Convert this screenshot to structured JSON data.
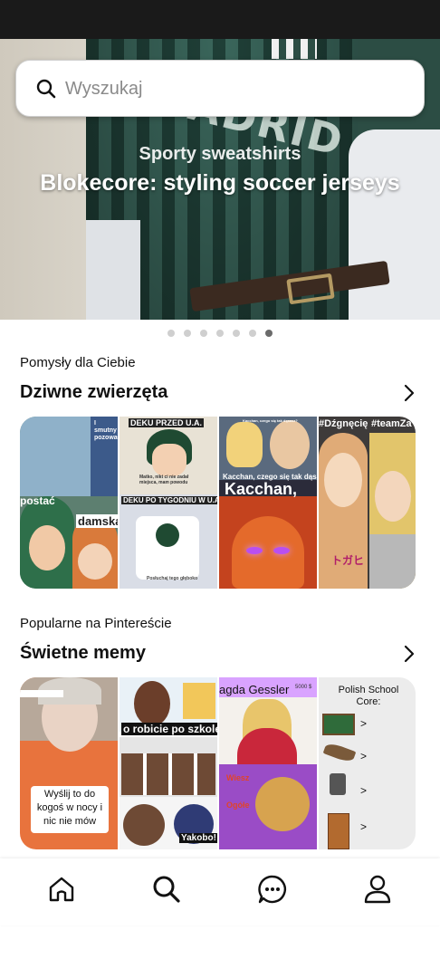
{
  "hero": {
    "subtitle": "Sporty sweatshirts",
    "title": "Blokecore: styling soccer jerseys",
    "jersey_text": "MADRID"
  },
  "search": {
    "placeholder": "Wyszukaj",
    "icon": "search-icon"
  },
  "carousel": {
    "count": 7,
    "active_index": 6
  },
  "section1": {
    "caption": "Pomysły dla Ciebie",
    "title": "Dziwne zwierzęta",
    "tiles": {
      "t1_top": "I smutny pozowała",
      "t1_bottom_left": "postać",
      "t1_bottom_right": "damska",
      "t2_top": "DEKU PRZED U.A.",
      "t2_caption": "Matko, nikt ci nie zadał miejsca, mam powodu",
      "t2_bottom": "DEKU PO TYGODNIU W U.A.",
      "t2_bed": "Posłuchaj tego głęboko",
      "t3_top": "Kacchan, czego się tak dąsasz?",
      "t3_big": "Kacchan,",
      "t3_small": "Kacchan, czego się tak dąsasz?",
      "t4_left": "#Dźgnęcię",
      "t4_right": "#teamZa",
      "t4_sign": "トガヒ"
    }
  },
  "section2": {
    "caption": "Popularne na Pintereście",
    "title": "Świetne memy",
    "tiles": {
      "m1_caption": "Wyślij to do kogoś w nocy i nic nie mów",
      "m2_top": "o robicie po szkole",
      "m2_yakobo": "Yakobo!",
      "m3_name": "agda Gessler",
      "m3_price": "5000 $",
      "m3_red1": "Wiesz",
      "m3_red2": "Ogółe",
      "m4_title": "Polish School Core:",
      "m4_arrow": ">"
    }
  },
  "nav": {
    "items": [
      "home-icon",
      "search-icon",
      "messages-icon",
      "profile-icon"
    ]
  },
  "colors": {
    "status_bar": "#1a1a1a",
    "accent_dot": "#6b6b6b",
    "dot": "#cfcfcf"
  }
}
